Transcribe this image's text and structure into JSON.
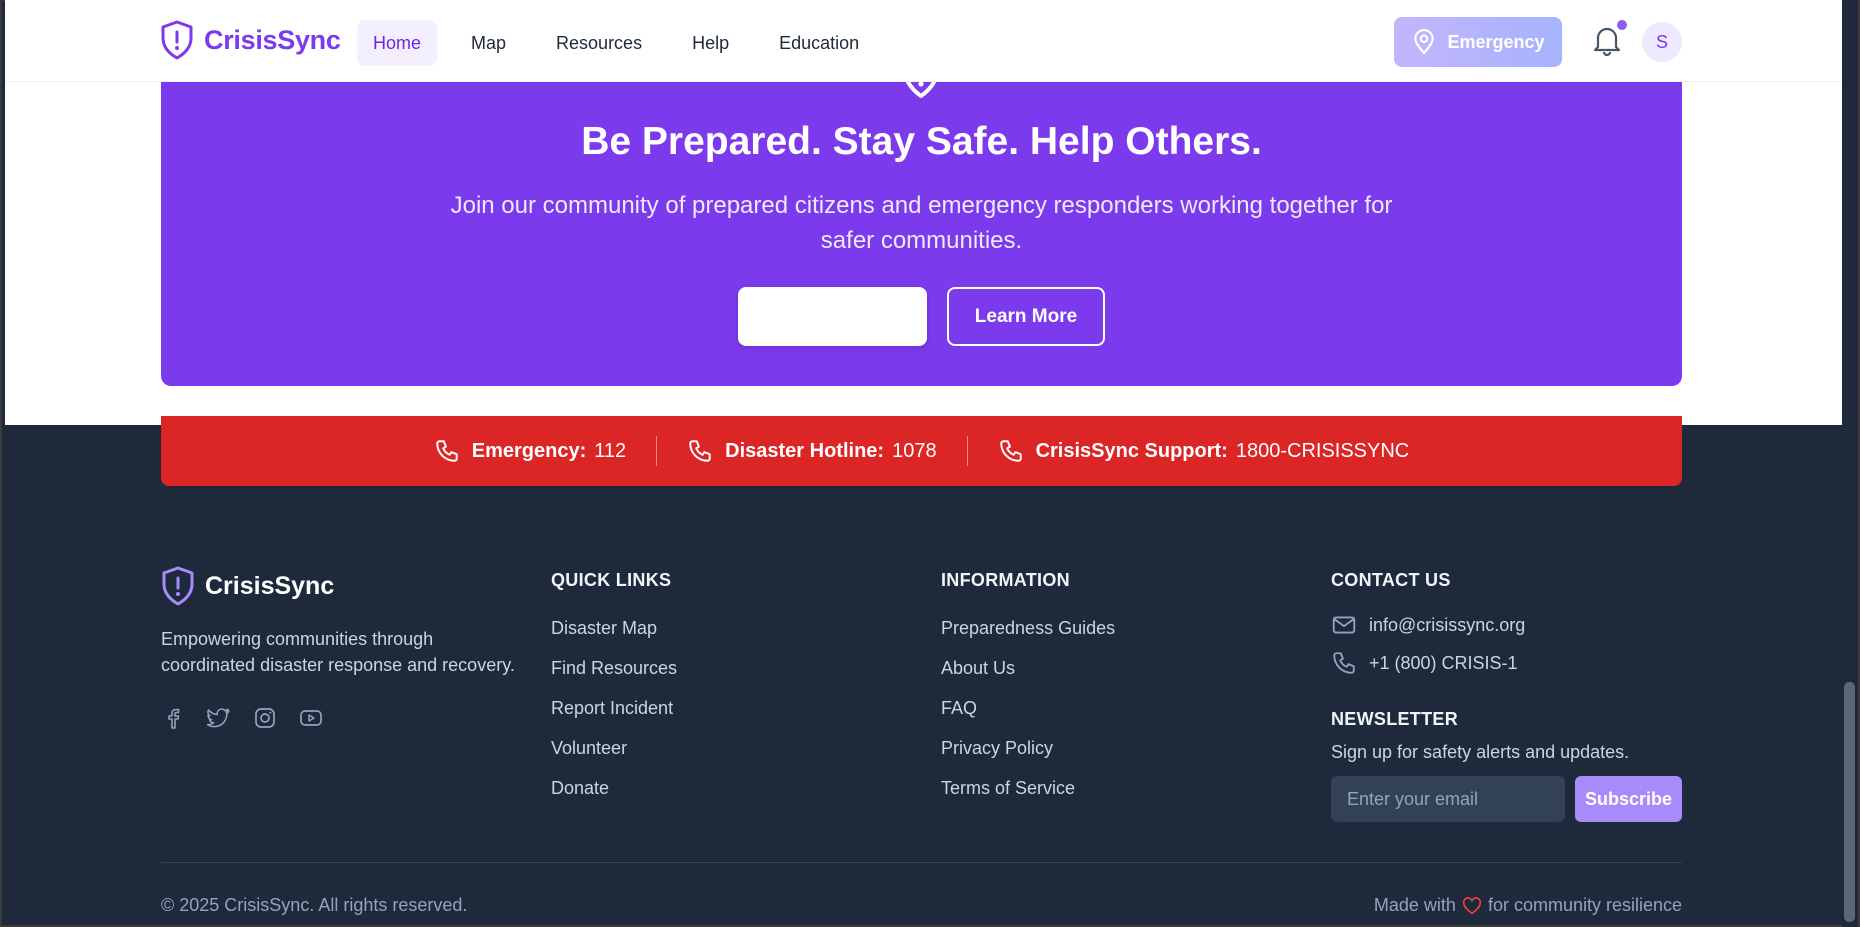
{
  "header": {
    "brand": "CrisisSync",
    "nav": [
      {
        "label": "Home",
        "active": true
      },
      {
        "label": "Map"
      },
      {
        "label": "Resources"
      },
      {
        "label": "Help"
      },
      {
        "label": "Education"
      }
    ],
    "emergency_label": "Emergency",
    "avatar_initial": "S",
    "icons": {
      "brand": "shield-alert-icon",
      "emergency": "map-pin-icon",
      "notifications": "bell-icon"
    }
  },
  "hero": {
    "title": "Be Prepared. Stay Safe. Help Others.",
    "subtitle": "Join our community of prepared citizens and emergency responders working together for safer communities.",
    "primary_button": "",
    "secondary_button": "Learn More"
  },
  "hotlines": [
    {
      "label": "Emergency:",
      "value": "112"
    },
    {
      "label": "Disaster Hotline:",
      "value": "1078"
    },
    {
      "label": "CrisisSync Support:",
      "value": "1800-CRISISSYNC"
    }
  ],
  "footer": {
    "brand": "CrisisSync",
    "description": "Empowering communities through coordinated disaster response and recovery.",
    "socials": [
      "facebook-icon",
      "twitter-icon",
      "instagram-icon",
      "youtube-icon"
    ],
    "quick_links": {
      "heading": "QUICK LINKS",
      "items": [
        "Disaster Map",
        "Find Resources",
        "Report Incident",
        "Volunteer",
        "Donate"
      ]
    },
    "information": {
      "heading": "INFORMATION",
      "items": [
        "Preparedness Guides",
        "About Us",
        "FAQ",
        "Privacy Policy",
        "Terms of Service"
      ]
    },
    "contact": {
      "heading": "CONTACT US",
      "email": "info@crisissync.org",
      "phone": "+1 (800) CRISIS-1"
    },
    "newsletter": {
      "heading": "NEWSLETTER",
      "text": "Sign up for safety alerts and updates.",
      "placeholder": "Enter your email",
      "button": "Subscribe"
    },
    "copyright": "© 2025 CrisisSync. All rights reserved.",
    "made_with_prefix": "Made with",
    "made_with_suffix": "for community resilience"
  },
  "colors": {
    "brand": "#7c3aed",
    "hero_bg": "#7c3aed",
    "hotline_bg": "#dc2626",
    "footer_bg": "#1e293b",
    "accent_light": "#a78bfa"
  }
}
